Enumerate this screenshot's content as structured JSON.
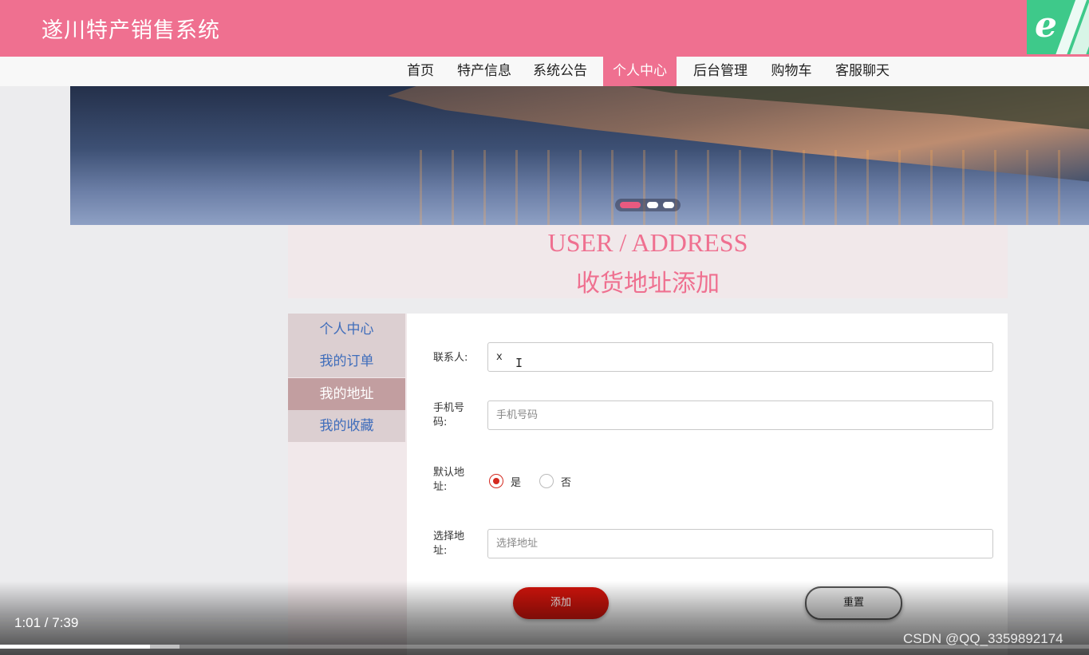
{
  "header": {
    "site_title": "遂川特产销售系统",
    "browser_badge_icon": "ie-logo-icon"
  },
  "nav": {
    "items": [
      {
        "label": "首页"
      },
      {
        "label": "特产信息"
      },
      {
        "label": "系统公告"
      },
      {
        "label": "个人中心",
        "active": true
      },
      {
        "label": "后台管理"
      },
      {
        "label": "购物车"
      },
      {
        "label": "客服聊天"
      }
    ]
  },
  "banner": {
    "carousel_active_index": 0,
    "carousel_count": 3
  },
  "section": {
    "title_en": "USER / ADDRESS",
    "title_zh": "收货地址添加"
  },
  "sidebar": {
    "items": [
      {
        "label": "个人中心"
      },
      {
        "label": "我的订单"
      },
      {
        "label": "我的地址",
        "active": true
      },
      {
        "label": "我的收藏"
      }
    ]
  },
  "form": {
    "contact": {
      "label": "联系人:",
      "value": "x",
      "placeholder": ""
    },
    "phone": {
      "label": "手机号码:",
      "value": "",
      "placeholder": "手机号码"
    },
    "default_address": {
      "label": "默认地址:",
      "options": [
        "是",
        "否"
      ],
      "selected": "是"
    },
    "address": {
      "label": "选择地址:",
      "value": "",
      "placeholder": "选择地址"
    },
    "add_button": "添加",
    "reset_button": "重置"
  },
  "video": {
    "time": "1:01 / 7:39",
    "progress_fraction": 0.138,
    "buffered_fraction": 0.165,
    "watermark": "CSDN @QQ_3359892174"
  },
  "colors": {
    "brand_pink": "#ef7090",
    "primary_red": "#d0140c",
    "link_blue": "#3f6dbb"
  }
}
